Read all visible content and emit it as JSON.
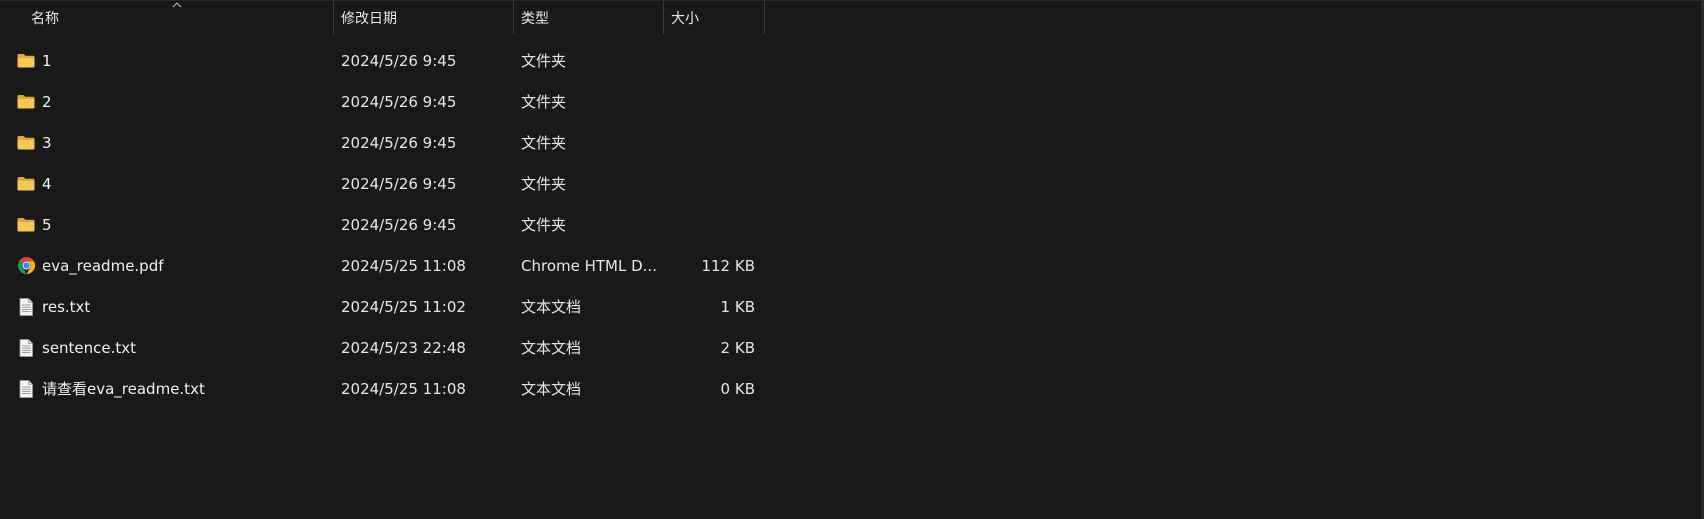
{
  "columns": {
    "name": "名称",
    "modified": "修改日期",
    "type": "类型",
    "size": "大小"
  },
  "sort": {
    "column": "name",
    "direction": "ascending"
  },
  "colors": {
    "background": "#191919",
    "folder": "#F8C94E",
    "text": "#E6E6E6"
  },
  "files": [
    {
      "name": "1",
      "modified": "2024/5/26 9:45",
      "type": "文件夹",
      "size": "",
      "icon": "folder-icon"
    },
    {
      "name": "2",
      "modified": "2024/5/26 9:45",
      "type": "文件夹",
      "size": "",
      "icon": "folder-icon"
    },
    {
      "name": "3",
      "modified": "2024/5/26 9:45",
      "type": "文件夹",
      "size": "",
      "icon": "folder-icon"
    },
    {
      "name": "4",
      "modified": "2024/5/26 9:45",
      "type": "文件夹",
      "size": "",
      "icon": "folder-icon"
    },
    {
      "name": "5",
      "modified": "2024/5/26 9:45",
      "type": "文件夹",
      "size": "",
      "icon": "folder-icon"
    },
    {
      "name": "eva_readme.pdf",
      "modified": "2024/5/25 11:08",
      "type": "Chrome HTML D...",
      "size": "112 KB",
      "icon": "chrome-icon"
    },
    {
      "name": "res.txt",
      "modified": "2024/5/25 11:02",
      "type": "文本文档",
      "size": "1 KB",
      "icon": "text-file-icon"
    },
    {
      "name": "sentence.txt",
      "modified": "2024/5/23 22:48",
      "type": "文本文档",
      "size": "2 KB",
      "icon": "text-file-icon"
    },
    {
      "name": "请查看eva_readme.txt",
      "modified": "2024/5/25 11:08",
      "type": "文本文档",
      "size": "0 KB",
      "icon": "text-file-icon"
    }
  ]
}
